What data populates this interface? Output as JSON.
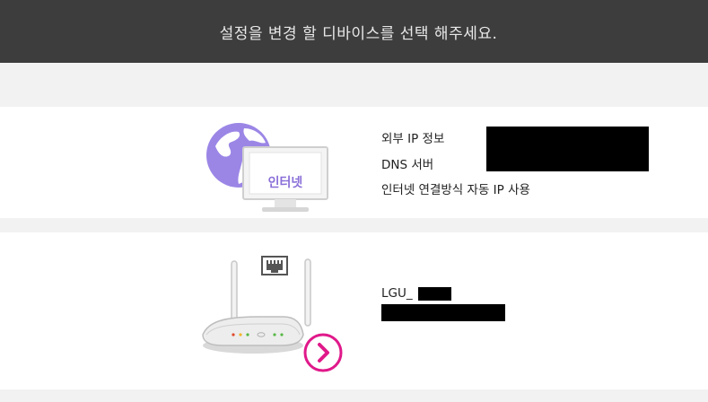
{
  "header": {
    "title": "설정을 변경 할 디바이스를 선택 해주세요."
  },
  "internet": {
    "badge_label": "인터넷",
    "rows": {
      "ip_label": "외부 IP 정보",
      "dns_label": "DNS 서버",
      "connection_label": "인터넷 연결방식",
      "connection_value": "자동 IP 사용"
    }
  },
  "router": {
    "ssid_prefix": "LGU_"
  },
  "colors": {
    "header_bg": "#3d3d3d",
    "accent_magenta": "#e0198a",
    "globe_purple": "#9b86e6",
    "background": "#f2f2f2"
  },
  "icons": {
    "globe": "globe-icon",
    "monitor": "monitor-icon",
    "router": "router-icon",
    "ethernet": "ethernet-port-icon",
    "arrow": "chevron-right-circle-icon"
  }
}
